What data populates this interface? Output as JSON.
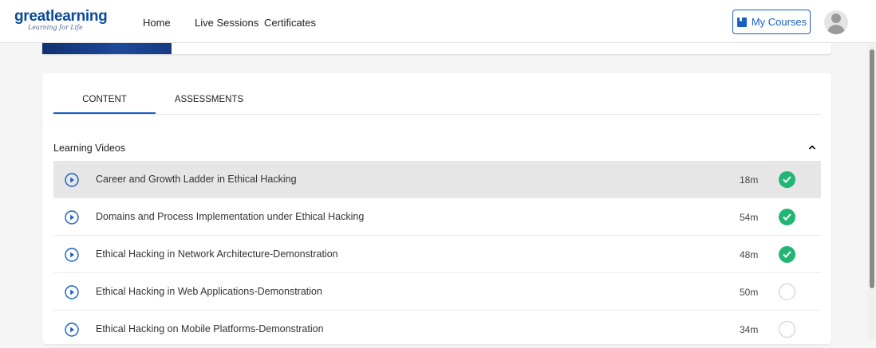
{
  "header": {
    "logo_text": "greatlearning",
    "logo_tagline": "Learning for Life",
    "nav": [
      {
        "label": "Home"
      },
      {
        "label": "Live Sessions"
      },
      {
        "label": "Certificates"
      }
    ],
    "my_courses_label": "My Courses"
  },
  "tabs": [
    {
      "label": "CONTENT",
      "active": true
    },
    {
      "label": "ASSESSMENTS",
      "active": false
    }
  ],
  "section": {
    "title": "Learning Videos",
    "expanded": true
  },
  "videos": [
    {
      "title": "Career and Growth Ladder in Ethical Hacking",
      "duration": "18m",
      "completed": true,
      "highlighted": true
    },
    {
      "title": "Domains and Process Implementation under Ethical Hacking",
      "duration": "54m",
      "completed": true,
      "highlighted": false
    },
    {
      "title": "Ethical Hacking in Network Architecture-Demonstration",
      "duration": "48m",
      "completed": true,
      "highlighted": false
    },
    {
      "title": "Ethical Hacking in Web Applications-Demonstration",
      "duration": "50m",
      "completed": false,
      "highlighted": false
    },
    {
      "title": "Ethical Hacking on Mobile Platforms-Demonstration",
      "duration": "34m",
      "completed": false,
      "highlighted": false
    }
  ],
  "colors": {
    "brand": "#0a4a9b",
    "accent": "#1a5fc4",
    "complete": "#22b573"
  },
  "icons": {
    "my_courses": "book-icon",
    "play": "play-circle-icon",
    "collapse": "chevron-up-icon",
    "complete": "check-circle-icon",
    "incomplete": "empty-circle-icon",
    "avatar": "user-avatar-icon"
  }
}
